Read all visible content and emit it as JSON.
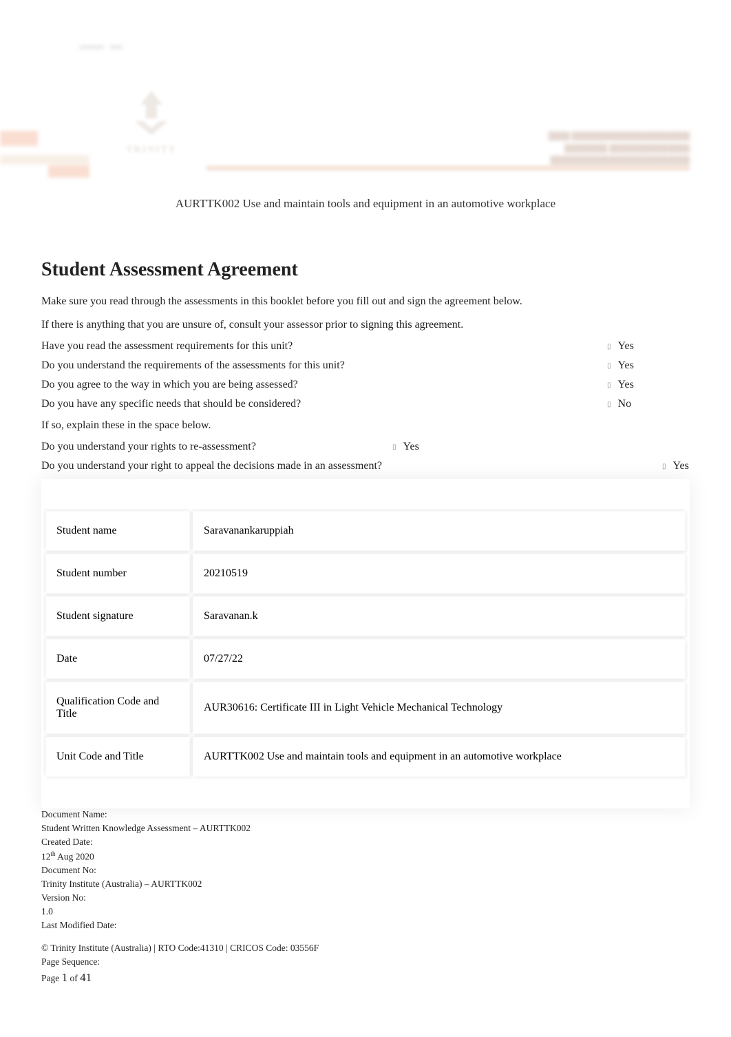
{
  "header": {
    "unit_title": "AURTTK002 Use and maintain tools and equipment in an automotive workplace"
  },
  "section": {
    "heading": "Student Assessment Agreement",
    "intro1": "Make sure you read through the assessments in this booklet before you fill out and sign the agreement below.",
    "intro2": "If there is anything that you are unsure of, consult your assessor prior to signing this agreement.",
    "questions": [
      {
        "q": "Have you read the assessment requirements for this unit?",
        "a": "Yes"
      },
      {
        "q": "Do you understand the requirements of the assessments for this unit?",
        "a": "Yes"
      },
      {
        "q": "Do you agree to the way in which you are being assessed?",
        "a": "Yes"
      },
      {
        "q": "Do you have any specific needs that should be considered?",
        "a": "No"
      }
    ],
    "explain_line": "If so, explain these in the space below.",
    "questions2": [
      {
        "q": "Do you understand your rights to re-assessment?",
        "a": "Yes"
      },
      {
        "q": "Do you understand your right to appeal the decisions made in an assessment?",
        "a": "Yes"
      }
    ]
  },
  "table": {
    "rows": [
      {
        "label": "Student name",
        "value": "Saravanankaruppiah"
      },
      {
        "label": "Student number",
        "value": "20210519"
      },
      {
        "label": "Student signature",
        "value": "Saravanan.k"
      },
      {
        "label": "Date",
        "value": "07/27/22"
      },
      {
        "label": "Qualification Code and Title",
        "value": "AUR30616: Certificate III in Light Vehicle Mechanical Technology"
      },
      {
        "label": "Unit Code and Title",
        "value": "AURTTK002 Use and maintain tools and equipment in an automotive workplace"
      }
    ]
  },
  "footer": {
    "doc_name_label": "Document Name:",
    "doc_name_value": "Student Written Knowledge Assessment – AURTTK002",
    "created_label": "Created Date:",
    "created_value_pre": "12",
    "created_value_sup": "th",
    "created_value_post": " Aug 2020",
    "doc_no_label": "Document No:",
    "doc_no_value": "Trinity Institute (Australia)   – AURTTK002",
    "version_label": "Version No:",
    "version_value": "1.0",
    "modified_label": "Last Modified Date:",
    "copyright": "© Trinity Institute (Australia) | RTO Code:41310 | CRICOS Code: 03556F",
    "page_seq_label": "Page Sequence:",
    "page_word": "Page ",
    "page_current": "1",
    "page_of": " of ",
    "page_total": "41"
  }
}
